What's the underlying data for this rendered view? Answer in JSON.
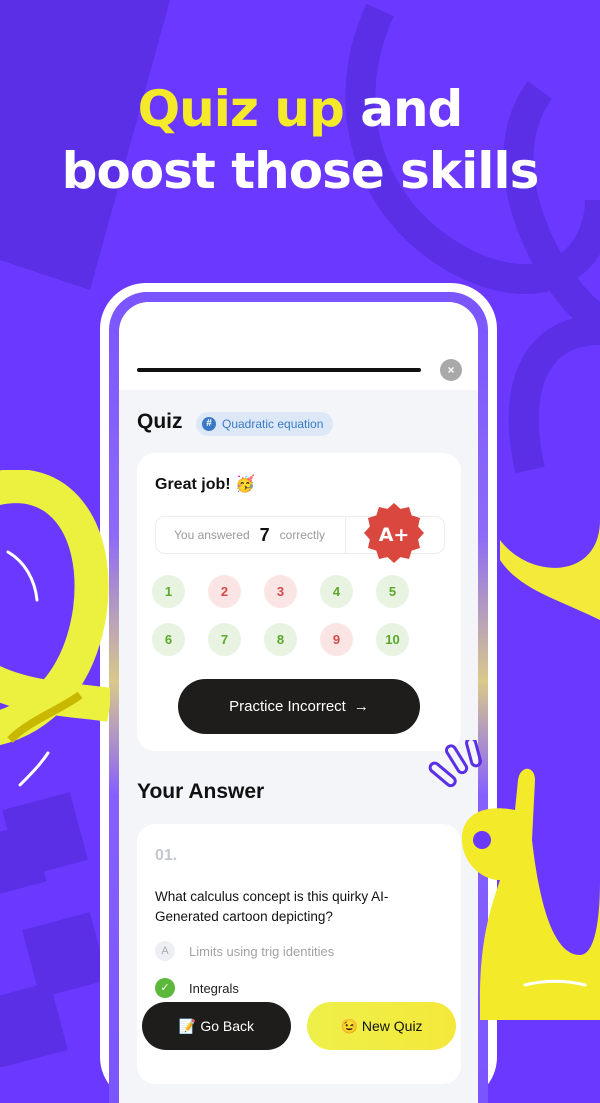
{
  "headline": {
    "highlight": "Quiz up",
    "line1_rest": " and",
    "line2": "boost those skills"
  },
  "colors": {
    "background": "#6a38ff",
    "highlight": "#f5ea2a",
    "correct": "#5aa82c",
    "wrong": "#d24b4b",
    "primary_button": "#1e1d1b",
    "secondary_button": "#f1ec3e"
  },
  "quiz": {
    "close_icon": "×",
    "title": "Quiz",
    "topic_icon": "#",
    "topic": "Quadratic equation",
    "progress": 1.0
  },
  "result": {
    "message": "Great job! 🥳",
    "answered_prefix": "You answered",
    "correct_count": "7",
    "answered_suffix": "correctly",
    "grade": "A+",
    "questions": [
      {
        "label": "1",
        "status": "correct"
      },
      {
        "label": "2",
        "status": "wrong"
      },
      {
        "label": "3",
        "status": "wrong"
      },
      {
        "label": "4",
        "status": "correct"
      },
      {
        "label": "5",
        "status": "correct"
      },
      {
        "label": "6",
        "status": "correct"
      },
      {
        "label": "7",
        "status": "correct"
      },
      {
        "label": "8",
        "status": "correct"
      },
      {
        "label": "9",
        "status": "wrong"
      },
      {
        "label": "10",
        "status": "correct"
      }
    ],
    "practice_button": "Practice Incorrect",
    "practice_arrow": "→"
  },
  "answers": {
    "heading": "Your Answer",
    "items": [
      {
        "number": "01.",
        "question": "What calculus concept is this quirky AI-Generated cartoon depicting?",
        "options": [
          {
            "marker": "A",
            "text": "Limits using trig identities",
            "selected": false
          },
          {
            "marker": "✓",
            "text": "Integrals",
            "selected": true
          }
        ]
      }
    ]
  },
  "buttons": {
    "go_back_icon": "📝",
    "go_back": "Go Back",
    "new_quiz_icon": "😉",
    "new_quiz": "New Quiz"
  }
}
